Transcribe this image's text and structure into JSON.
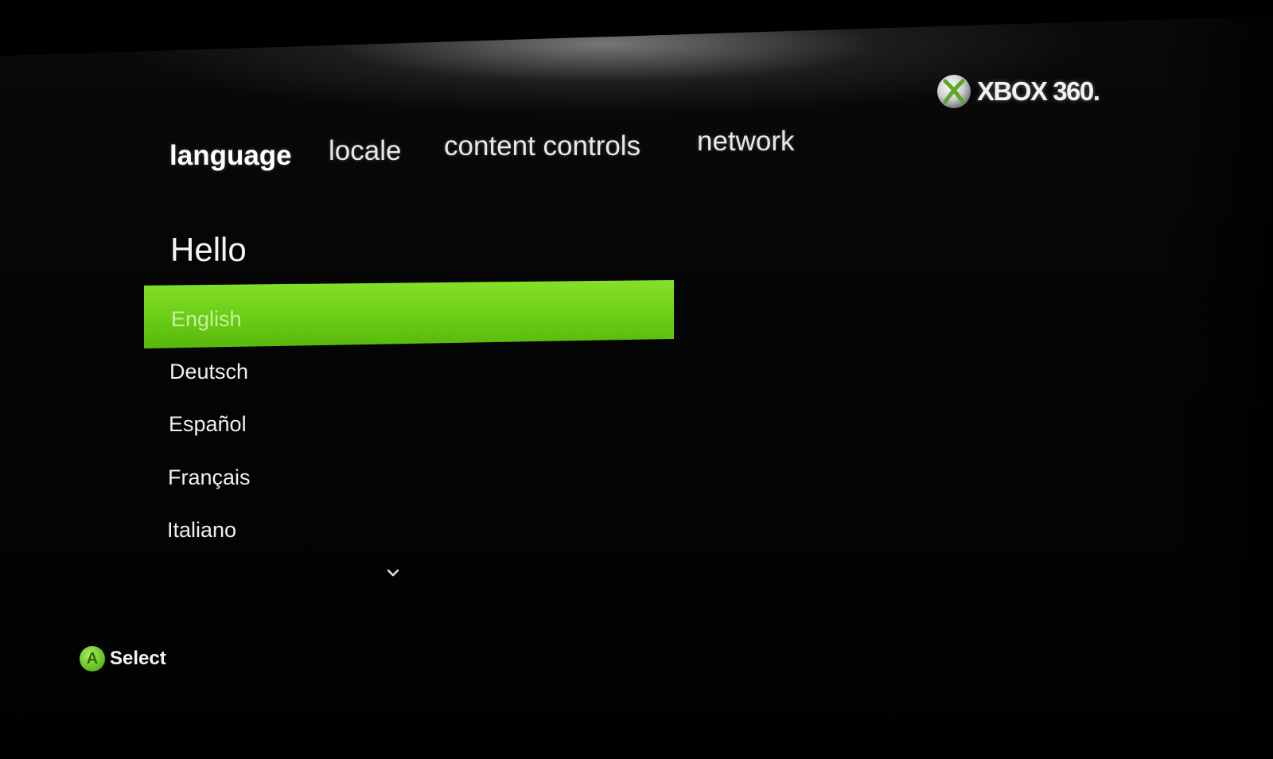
{
  "brand": {
    "logo_text": "XBOX 360.",
    "logo_icon": "xbox-sphere-icon",
    "accent_color": "#6fd118"
  },
  "tabs": [
    {
      "label": "language",
      "active": true
    },
    {
      "label": "locale",
      "active": false
    },
    {
      "label": "content controls",
      "active": false
    },
    {
      "label": "network",
      "active": false
    }
  ],
  "heading": "Hello",
  "languages": [
    {
      "label": "English",
      "selected": true
    },
    {
      "label": "Deutsch",
      "selected": false
    },
    {
      "label": "Español",
      "selected": false
    },
    {
      "label": "Français",
      "selected": false
    },
    {
      "label": "Italiano",
      "selected": false
    }
  ],
  "scroll_indicator_icon": "chevron-down-icon",
  "footer": {
    "button_glyph": "A",
    "button_icon": "a-button-icon",
    "action_label": "Select"
  }
}
